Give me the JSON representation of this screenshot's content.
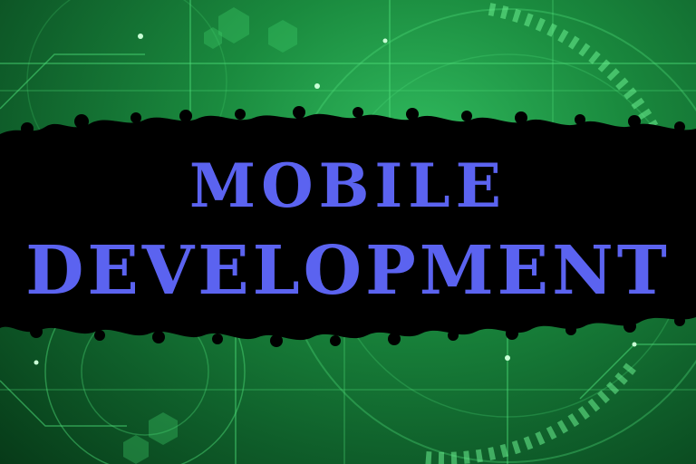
{
  "title": {
    "line1": "MOBILE",
    "line2": "DEVELOPMENT"
  },
  "colors": {
    "background": "#1a8a3e",
    "banner": "#000000",
    "title_text": "#5b63f0",
    "circuit_lines": "#4fe07a"
  },
  "decorations": {
    "background": "green-circuit-tech-pattern",
    "banner": "black-foliage-silhouette-strip"
  }
}
